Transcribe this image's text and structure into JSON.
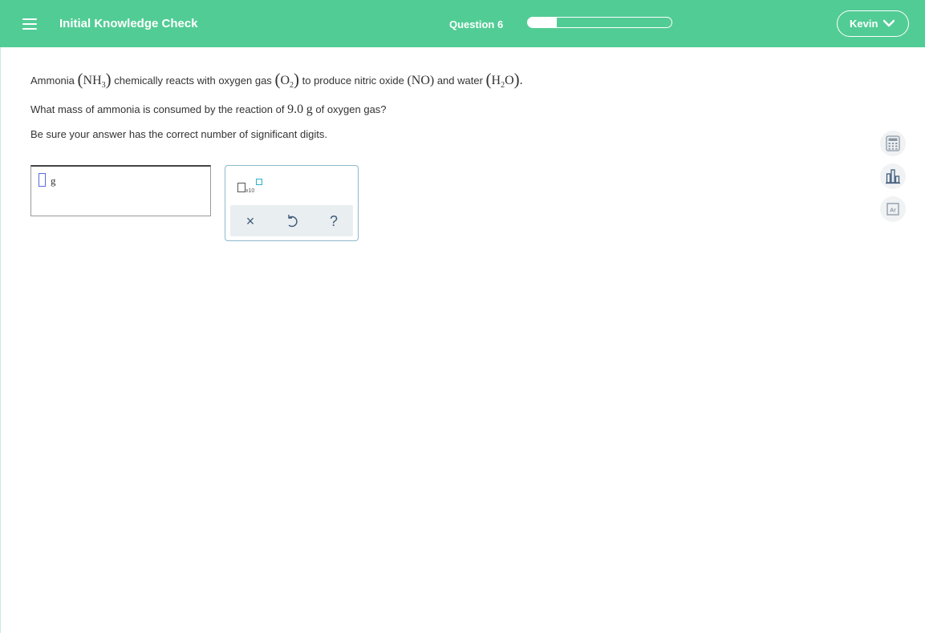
{
  "header": {
    "title": "Initial Knowledge Check",
    "question_label": "Question 6",
    "progress_fraction": 0.2,
    "user_name": "Kevin"
  },
  "question": {
    "ammonia_word": "Ammonia",
    "nh3_base": "NH",
    "nh3_sub": "3",
    "reacts_text": "chemically reacts with oxygen gas",
    "o2_base": "O",
    "o2_sub": "2",
    "produce_text": "to produce nitric oxide",
    "no_formula": "NO",
    "and_water": "and water",
    "h2o_h": "H",
    "h2o_sub": "2",
    "h2o_o": "O",
    "period": ".",
    "q2_pre": "What mass of ammonia is consumed by the reaction of",
    "q2_value": "9.0",
    "q2_unit": "g",
    "q2_post": "of oxygen gas?",
    "q3": "Be sure your answer has the correct number of significant digits."
  },
  "answer": {
    "unit": "g"
  },
  "tools": {
    "sci_notation_text": "x10",
    "clear_glyph": "×",
    "help_glyph": "?"
  },
  "side_tools": {
    "calculator_icon": "calculator-icon",
    "chart_icon": "bar-chart-icon",
    "periodic_icon": "periodic-table-icon",
    "periodic_symbol": "Ar"
  },
  "colors": {
    "header_bg": "#52cc95",
    "cursor_border": "#5a6ad8",
    "exponent_box": "#2ab0c9",
    "tool_icon": "#3e5a7a"
  }
}
